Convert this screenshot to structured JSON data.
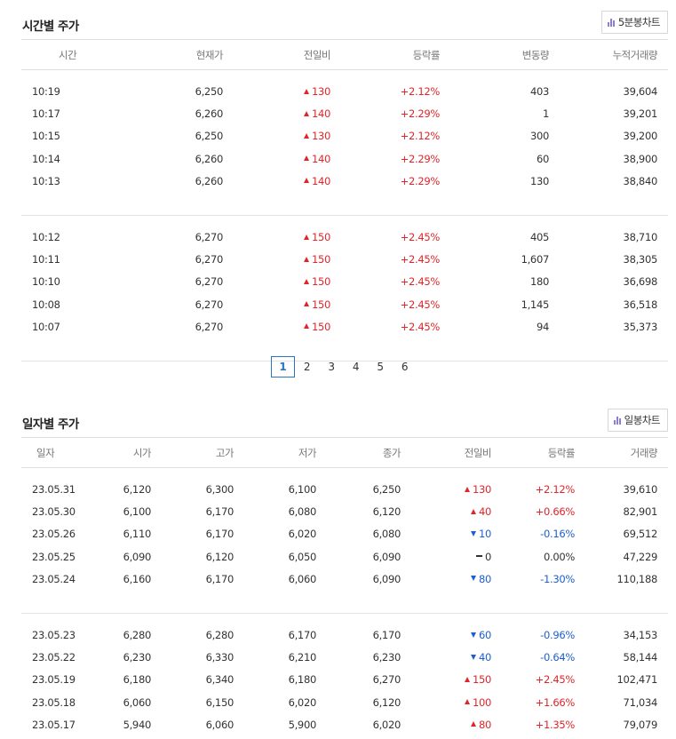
{
  "time_section": {
    "title": "시간별 주가",
    "chart_button": "5분봉차트",
    "headers": [
      "시간",
      "현재가",
      "전일비",
      "등락률",
      "변동량",
      "누적거래량"
    ],
    "groups": [
      [
        {
          "time": "10:19",
          "price": "6,250",
          "dir": "up",
          "change": "130",
          "rate": "+2.12%",
          "vol": "403",
          "cum": "39,604"
        },
        {
          "time": "10:17",
          "price": "6,260",
          "dir": "up",
          "change": "140",
          "rate": "+2.29%",
          "vol": "1",
          "cum": "39,201"
        },
        {
          "time": "10:15",
          "price": "6,250",
          "dir": "up",
          "change": "130",
          "rate": "+2.12%",
          "vol": "300",
          "cum": "39,200"
        },
        {
          "time": "10:14",
          "price": "6,260",
          "dir": "up",
          "change": "140",
          "rate": "+2.29%",
          "vol": "60",
          "cum": "38,900"
        },
        {
          "time": "10:13",
          "price": "6,260",
          "dir": "up",
          "change": "140",
          "rate": "+2.29%",
          "vol": "130",
          "cum": "38,840"
        }
      ],
      [
        {
          "time": "10:12",
          "price": "6,270",
          "dir": "up",
          "change": "150",
          "rate": "+2.45%",
          "vol": "405",
          "cum": "38,710"
        },
        {
          "time": "10:11",
          "price": "6,270",
          "dir": "up",
          "change": "150",
          "rate": "+2.45%",
          "vol": "1,607",
          "cum": "38,305"
        },
        {
          "time": "10:10",
          "price": "6,270",
          "dir": "up",
          "change": "150",
          "rate": "+2.45%",
          "vol": "180",
          "cum": "36,698"
        },
        {
          "time": "10:08",
          "price": "6,270",
          "dir": "up",
          "change": "150",
          "rate": "+2.45%",
          "vol": "1,145",
          "cum": "36,518"
        },
        {
          "time": "10:07",
          "price": "6,270",
          "dir": "up",
          "change": "150",
          "rate": "+2.45%",
          "vol": "94",
          "cum": "35,373"
        }
      ]
    ],
    "pages": [
      "1",
      "2",
      "3",
      "4",
      "5",
      "6"
    ],
    "active_page": "1"
  },
  "daily_section": {
    "title": "일자별 주가",
    "chart_button": "일봉차트",
    "headers": [
      "일자",
      "시가",
      "고가",
      "저가",
      "종가",
      "전일비",
      "등락률",
      "거래량"
    ],
    "groups": [
      [
        {
          "date": "23.05.31",
          "open": "6,120",
          "high": "6,300",
          "low": "6,100",
          "close": "6,250",
          "dir": "up",
          "change": "130",
          "rate": "+2.12%",
          "vol": "39,610"
        },
        {
          "date": "23.05.30",
          "open": "6,100",
          "high": "6,170",
          "low": "6,080",
          "close": "6,120",
          "dir": "up",
          "change": "40",
          "rate": "+0.66%",
          "vol": "82,901"
        },
        {
          "date": "23.05.26",
          "open": "6,110",
          "high": "6,170",
          "low": "6,020",
          "close": "6,080",
          "dir": "down",
          "change": "10",
          "rate": "-0.16%",
          "vol": "69,512"
        },
        {
          "date": "23.05.25",
          "open": "6,090",
          "high": "6,120",
          "low": "6,050",
          "close": "6,090",
          "dir": "flat",
          "change": "0",
          "rate": "0.00%",
          "vol": "47,229"
        },
        {
          "date": "23.05.24",
          "open": "6,160",
          "high": "6,170",
          "low": "6,060",
          "close": "6,090",
          "dir": "down",
          "change": "80",
          "rate": "-1.30%",
          "vol": "110,188"
        }
      ],
      [
        {
          "date": "23.05.23",
          "open": "6,280",
          "high": "6,280",
          "low": "6,170",
          "close": "6,170",
          "dir": "down",
          "change": "60",
          "rate": "-0.96%",
          "vol": "34,153"
        },
        {
          "date": "23.05.22",
          "open": "6,230",
          "high": "6,330",
          "low": "6,210",
          "close": "6,230",
          "dir": "down",
          "change": "40",
          "rate": "-0.64%",
          "vol": "58,144"
        },
        {
          "date": "23.05.19",
          "open": "6,180",
          "high": "6,340",
          "low": "6,180",
          "close": "6,270",
          "dir": "up",
          "change": "150",
          "rate": "+2.45%",
          "vol": "102,471"
        },
        {
          "date": "23.05.18",
          "open": "6,060",
          "high": "6,150",
          "low": "6,020",
          "close": "6,120",
          "dir": "up",
          "change": "100",
          "rate": "+1.66%",
          "vol": "71,034"
        },
        {
          "date": "23.05.17",
          "open": "5,940",
          "high": "6,060",
          "low": "5,900",
          "close": "6,020",
          "dir": "up",
          "change": "80",
          "rate": "+1.35%",
          "vol": "79,079"
        }
      ]
    ]
  },
  "colors": {
    "up": "#e0252a",
    "down": "#1d5fd0",
    "active_page": "#2a76c6",
    "chart_icon": "#8a7fd0"
  },
  "icons": {
    "chart_button": "bar-chart-icon",
    "up": "triangle-up-icon",
    "down": "triangle-down-icon",
    "flat": "dash-icon"
  }
}
